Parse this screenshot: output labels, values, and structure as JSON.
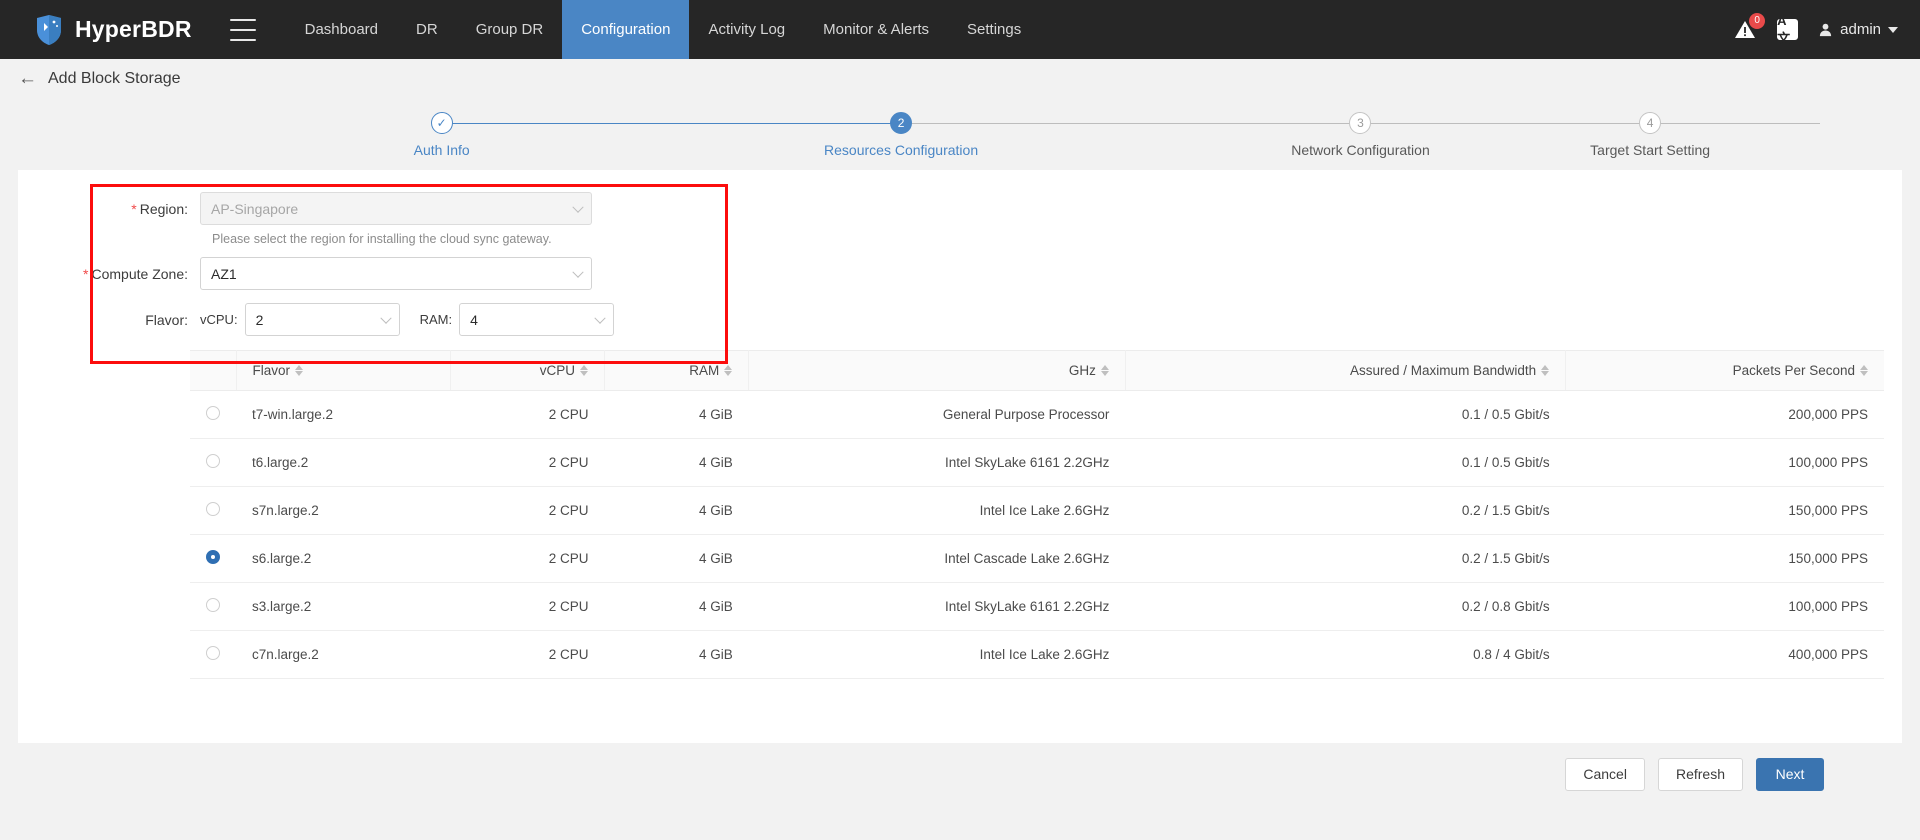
{
  "navbar": {
    "brand": "HyperBDR",
    "menu_icon": "hamburger-icon",
    "items": [
      {
        "label": "Dashboard",
        "active": false
      },
      {
        "label": "DR",
        "active": false
      },
      {
        "label": "Group DR",
        "active": false
      },
      {
        "label": "Configuration",
        "active": true
      },
      {
        "label": "Activity Log",
        "active": false
      },
      {
        "label": "Monitor & Alerts",
        "active": false
      },
      {
        "label": "Settings",
        "active": false
      }
    ],
    "alert_badge": "0",
    "lang_icon_label": "A文",
    "user": "admin",
    "accent": "#4a86c5"
  },
  "page": {
    "back_label": "←",
    "title": "Add Block Storage"
  },
  "stepper": {
    "steps": [
      {
        "num": "✓",
        "label": "Auth Info",
        "state": "done"
      },
      {
        "num": "2",
        "label": "Resources Configuration",
        "state": "current"
      },
      {
        "num": "3",
        "label": "Network Configuration",
        "state": "todo"
      },
      {
        "num": "4",
        "label": "Target Start Setting",
        "state": "todo"
      }
    ]
  },
  "form": {
    "region": {
      "label": "Region:",
      "required": true,
      "value": "AP-Singapore",
      "disabled": true,
      "hint": "Please select the region for installing the cloud sync gateway."
    },
    "compute_zone": {
      "label": "Compute Zone:",
      "required": true,
      "value": "AZ1"
    },
    "flavor": {
      "label": "Flavor:",
      "vcpu_label": "vCPU:",
      "vcpu_value": "2",
      "ram_label": "RAM:",
      "ram_value": "4"
    },
    "highlight_color": "#fc0d0d"
  },
  "table": {
    "columns": [
      {
        "label": "Flavor",
        "align": "left",
        "sortable": true
      },
      {
        "label": "vCPU",
        "align": "right",
        "sortable": true
      },
      {
        "label": "RAM",
        "align": "right",
        "sortable": true
      },
      {
        "label": "GHz",
        "align": "right",
        "sortable": true
      },
      {
        "label": "Assured / Maximum Bandwidth",
        "align": "right",
        "sortable": true
      },
      {
        "label": "Packets Per Second",
        "align": "right",
        "sortable": true
      }
    ],
    "rows": [
      {
        "selected": false,
        "flavor": "t7-win.large.2",
        "vcpu": "2 CPU",
        "ram": "4 GiB",
        "ghz": "General Purpose Processor",
        "bandwidth": "0.1 / 0.5 Gbit/s",
        "pps": "200,000 PPS"
      },
      {
        "selected": false,
        "flavor": "t6.large.2",
        "vcpu": "2 CPU",
        "ram": "4 GiB",
        "ghz": "Intel SkyLake 6161 2.2GHz",
        "bandwidth": "0.1 / 0.5 Gbit/s",
        "pps": "100,000 PPS"
      },
      {
        "selected": false,
        "flavor": "s7n.large.2",
        "vcpu": "2 CPU",
        "ram": "4 GiB",
        "ghz": "Intel Ice Lake 2.6GHz",
        "bandwidth": "0.2 / 1.5 Gbit/s",
        "pps": "150,000 PPS"
      },
      {
        "selected": true,
        "flavor": "s6.large.2",
        "vcpu": "2 CPU",
        "ram": "4 GiB",
        "ghz": "Intel Cascade Lake 2.6GHz",
        "bandwidth": "0.2 / 1.5 Gbit/s",
        "pps": "150,000 PPS"
      },
      {
        "selected": false,
        "flavor": "s3.large.2",
        "vcpu": "2 CPU",
        "ram": "4 GiB",
        "ghz": "Intel SkyLake 6161 2.2GHz",
        "bandwidth": "0.2 / 0.8 Gbit/s",
        "pps": "100,000 PPS"
      },
      {
        "selected": false,
        "flavor": "c7n.large.2",
        "vcpu": "2 CPU",
        "ram": "4 GiB",
        "ghz": "Intel Ice Lake 2.6GHz",
        "bandwidth": "0.8 / 4 Gbit/s",
        "pps": "400,000 PPS"
      }
    ]
  },
  "footer": {
    "cancel": "Cancel",
    "refresh": "Refresh",
    "next": "Next",
    "primary_color": "#3a74b0"
  }
}
